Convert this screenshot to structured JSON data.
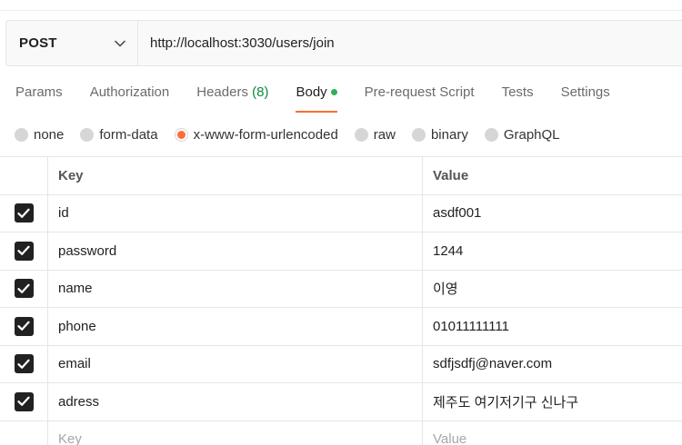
{
  "request": {
    "method": "POST",
    "url": "http://localhost:3030/users/join"
  },
  "tabs": [
    {
      "label": "Params"
    },
    {
      "label": "Authorization"
    },
    {
      "label": "Headers",
      "count": "(8)"
    },
    {
      "label": "Body",
      "active": true,
      "indicator": "green-dot"
    },
    {
      "label": "Pre-request Script"
    },
    {
      "label": "Tests"
    },
    {
      "label": "Settings"
    }
  ],
  "body_types": {
    "options": [
      "none",
      "form-data",
      "x-www-form-urlencoded",
      "raw",
      "binary",
      "GraphQL"
    ],
    "selected": "x-www-form-urlencoded"
  },
  "table": {
    "headers": {
      "key": "Key",
      "value": "Value"
    },
    "rows": [
      {
        "key": "id",
        "value": "asdf001",
        "checked": true
      },
      {
        "key": "password",
        "value": "1244",
        "checked": true
      },
      {
        "key": "name",
        "value": "이영",
        "checked": true
      },
      {
        "key": "phone",
        "value": "01011111111",
        "checked": true
      },
      {
        "key": "email",
        "value": "sdfjsdfj@naver.com",
        "checked": true
      },
      {
        "key": "adress",
        "value": "제주도 여기저기구 신나구",
        "checked": true
      }
    ],
    "placeholder": {
      "key": "Key",
      "value": "Value"
    }
  },
  "colors": {
    "accent": "#ff6c37",
    "count_green": "#0e8a3e",
    "dot_green": "#2fb158",
    "checkbox": "#212121"
  }
}
